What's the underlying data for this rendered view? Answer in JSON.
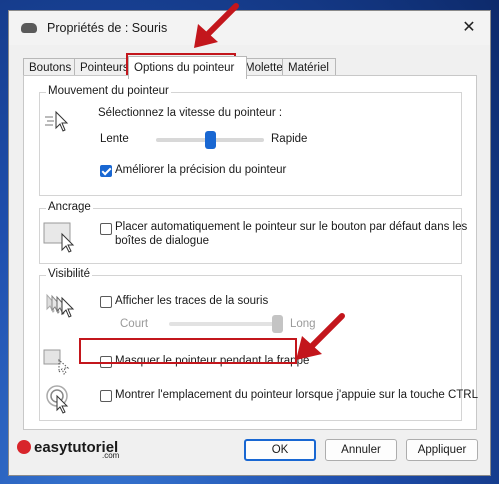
{
  "window": {
    "title": "Propriétés de : Souris",
    "close_glyph": "✕"
  },
  "tabs": [
    {
      "label": "Boutons"
    },
    {
      "label": "Pointeurs"
    },
    {
      "label": "Options du pointeur"
    },
    {
      "label": "Molette"
    },
    {
      "label": "Matériel"
    }
  ],
  "motion": {
    "title": "Mouvement du pointeur",
    "speed_label": "Sélectionnez la vitesse du pointeur :",
    "slow": "Lente",
    "fast": "Rapide",
    "speed_fraction": 0.5,
    "precision_label": "Améliorer la précision du pointeur",
    "precision_checked": true
  },
  "snap": {
    "title": "Ancrage",
    "label_line1": "Placer automatiquement le pointeur sur le bouton par défaut dans les",
    "label_line2": "boîtes de dialogue",
    "checked": false
  },
  "visibility": {
    "title": "Visibilité",
    "trails_label": "Afficher les traces de la souris",
    "trails_checked": false,
    "short": "Court",
    "long": "Long",
    "trail_fraction": 1.0,
    "hide_label": "Masquer le pointeur pendant la frappe",
    "hide_checked": false,
    "ctrl_label": "Montrer l'emplacement du pointeur lorsque j'appuie sur la touche CTRL",
    "ctrl_checked": false
  },
  "buttons": {
    "ok": "OK",
    "cancel": "Annuler",
    "apply": "Appliquer"
  },
  "watermark": {
    "text": "easytutoriel",
    "suffix": ".com"
  },
  "colors": {
    "accent": "#1967d2",
    "highlight": "#c3161c"
  }
}
